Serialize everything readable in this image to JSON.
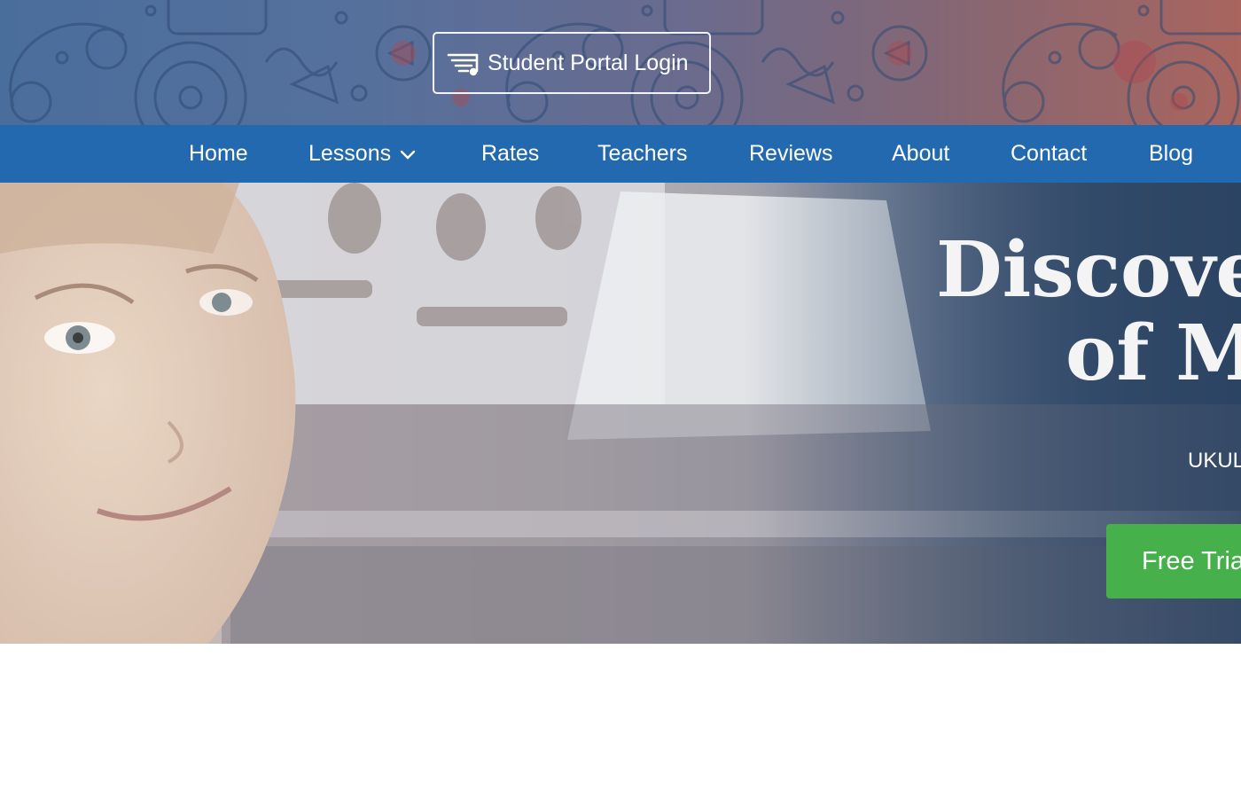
{
  "header": {
    "portal_login_label": "Student Portal Login",
    "portal_icon": "lines-music-note-icon"
  },
  "nav": {
    "items": [
      {
        "label": "Home"
      },
      {
        "label": "Lessons",
        "has_dropdown": true
      },
      {
        "label": "Rates"
      },
      {
        "label": "Teachers"
      },
      {
        "label": "Reviews"
      },
      {
        "label": "About"
      },
      {
        "label": "Contact"
      },
      {
        "label": "Blog"
      }
    ]
  },
  "hero": {
    "title_line1": "Discover",
    "title_line2": "of M",
    "subtitle": "UKUL",
    "cta_label": "Free Tria"
  },
  "colors": {
    "nav_background": "#2269b0",
    "cta_green": "#46b04a",
    "hero_text": "#f4f4f4"
  }
}
